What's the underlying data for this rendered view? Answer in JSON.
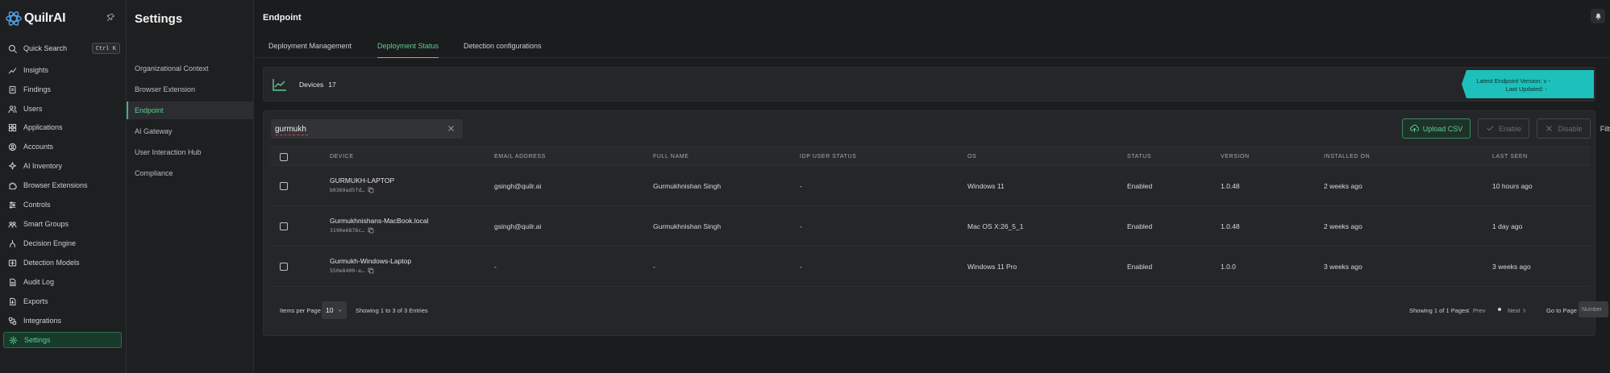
{
  "app": {
    "name": "QuilrAI"
  },
  "nav": {
    "quick_search": {
      "label": "Quick Search",
      "shortcut": "Ctrl K"
    },
    "items": [
      {
        "label": "Insights",
        "icon": "chart-line-icon"
      },
      {
        "label": "Findings",
        "icon": "findings-icon"
      },
      {
        "label": "Users",
        "icon": "users-icon"
      },
      {
        "label": "Applications",
        "icon": "apps-grid-icon"
      },
      {
        "label": "Accounts",
        "icon": "account-icon"
      },
      {
        "label": "AI Inventory",
        "icon": "ai-inventory-icon"
      },
      {
        "label": "Browser Extensions",
        "icon": "puzzle-icon"
      },
      {
        "label": "Controls",
        "icon": "controls-icon"
      },
      {
        "label": "Smart Groups",
        "icon": "groups-icon"
      },
      {
        "label": "Decision Engine",
        "icon": "decision-icon"
      },
      {
        "label": "Detection Models",
        "icon": "detection-icon"
      },
      {
        "label": "Audit Log",
        "icon": "audit-log-icon"
      },
      {
        "label": "Exports",
        "icon": "export-icon"
      },
      {
        "label": "Integrations",
        "icon": "integrations-icon"
      },
      {
        "label": "Settings",
        "icon": "gear-icon",
        "active": true
      }
    ]
  },
  "settings": {
    "title": "Settings",
    "items": [
      {
        "label": "Organizational Context"
      },
      {
        "label": "Browser Extension"
      },
      {
        "label": "Endpoint",
        "active": true
      },
      {
        "label": "AI Gateway"
      },
      {
        "label": "User Interaction Hub"
      },
      {
        "label": "Compliance"
      }
    ]
  },
  "main": {
    "title": "Endpoint",
    "tabs": [
      {
        "label": "Deployment Management"
      },
      {
        "label": "Deployment Status",
        "active": true
      },
      {
        "label": "Detection configurations"
      }
    ],
    "devices": {
      "label": "Devices",
      "count": "17"
    },
    "version_badge": {
      "line1": "Latest Endpoint Version: v -",
      "line2": "Last Updated: -"
    },
    "search": {
      "value": "gurmukh",
      "placeholder": ""
    },
    "buttons": {
      "upload": "Upload CSV",
      "enable": "Enable",
      "disable": "Disable",
      "filters": "Filters"
    },
    "columns": [
      "DEVICE",
      "EMAIL ADDRESS",
      "FULL NAME",
      "IDP USER STATUS",
      "OS",
      "STATUS",
      "VERSION",
      "INSTALLED ON",
      "LAST SEEN"
    ],
    "rows": [
      {
        "device": "GURMUKH-LAPTOP",
        "device_id": "b0369ad5fd…",
        "email": "gsingh@quilr.ai",
        "full_name": "Gurmukhnishan Singh",
        "idp_status": "-",
        "os": "Windows 11",
        "status": "Enabled",
        "version": "1.0.48",
        "installed_on": "2 weeks ago",
        "last_seen": "10 hours ago"
      },
      {
        "device": "Gurmukhnishans-MacBook.local",
        "device_id": "3190e6878c…",
        "email": "gsingh@quilr.ai",
        "full_name": "Gurmukhnishan Singh",
        "idp_status": "-",
        "os": "Mac OS X:26_5_1",
        "status": "Enabled",
        "version": "1.0.48",
        "installed_on": "2 weeks ago",
        "last_seen": "1 day ago"
      },
      {
        "device": "Gurmukh-Windows-Laptop",
        "device_id": "550e8400-e…",
        "email": "-",
        "full_name": "-",
        "idp_status": "-",
        "os": "Windows 11 Pro",
        "status": "Enabled",
        "version": "1.0.0",
        "installed_on": "3 weeks ago",
        "last_seen": "3 weeks ago"
      }
    ],
    "footer": {
      "items_per_page_label": "Items per Page",
      "per_page_value": "10",
      "entries_text": "Showing 1 to 3 of 3 Entries",
      "pages_text": "Showing 1 of 1 Pages",
      "prev": "Prev",
      "next": "Next",
      "goto_label": "Go to Page",
      "goto_placeholder": "Number"
    }
  },
  "colors": {
    "accent": "#5bd08f",
    "brand": "#4ea0e6",
    "badge": "#1ec0bb",
    "background": "#1b1c1e"
  }
}
